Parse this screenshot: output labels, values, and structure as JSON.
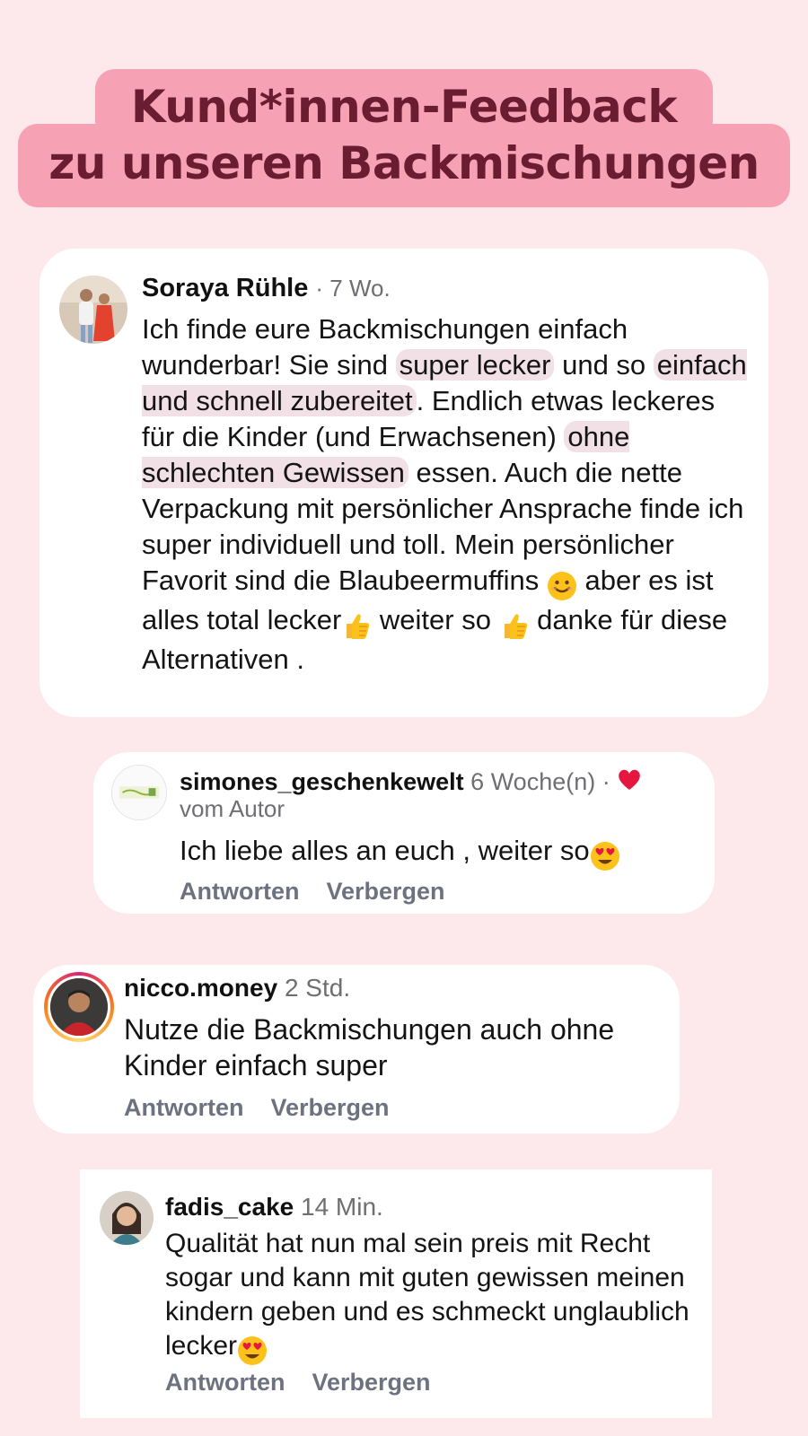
{
  "title": {
    "line1": "Kund*innen-Feedback",
    "line2": "zu unseren Backmischungen"
  },
  "colors": {
    "background": "#fde8ec",
    "title_bg": "#f7a1b5",
    "title_text": "#6a1c30",
    "highlight": "#f1e0e5",
    "action_text": "#6e7280",
    "heart": "#e5173f"
  },
  "comments": [
    {
      "username": "Soraya Rühle",
      "time": "· 7 Wo.",
      "body": {
        "p1": "Ich finde eure Backmischungen einfach wunderbar! Sie sind ",
        "hl1": "super lecker",
        "p2": " und so ",
        "hl2": "einfach und schnell zubereitet",
        "p3": ". Endlich etwas leckeres für die Kinder (und Erwachsenen) ",
        "hl3": "ohne schlechten Gewissen",
        "p4": " essen. Auch die nette Verpackung mit persönlicher Ansprache finde ich super individuell und toll. Mein persönlicher Favorit sind die Blaubeermuffins ",
        "p5": " aber es ist alles total lecker",
        "p6": " weiter so ",
        "p7": " danke für diese Alternativen ."
      },
      "emojis": [
        "smiling-face-emoji",
        "thumbs-up-emoji",
        "thumbs-up-emoji"
      ]
    },
    {
      "username": "simones_geschenkewelt",
      "time": "6 Woche(n) ·",
      "liked_by": "vom Autor",
      "body": "Ich liebe alles an euch , weiter so",
      "emoji": "heart-eyes-emoji",
      "reply_label": "Antworten",
      "hide_label": "Verbergen"
    },
    {
      "username": "nicco.money",
      "time": "2 Std.",
      "body": "Nutze die Backmischungen auch ohne Kinder einfach super",
      "reply_label": "Antworten",
      "hide_label": "Verbergen"
    },
    {
      "username": "fadis_cake",
      "time": "14 Min.",
      "body": "Qualität hat nun mal sein preis  mit Recht sogar  und kann mit guten gewissen meinen kindern geben und es schmeckt unglaublich lecker",
      "emoji": "heart-eyes-emoji",
      "reply_label": "Antworten",
      "hide_label": "Verbergen"
    }
  ]
}
